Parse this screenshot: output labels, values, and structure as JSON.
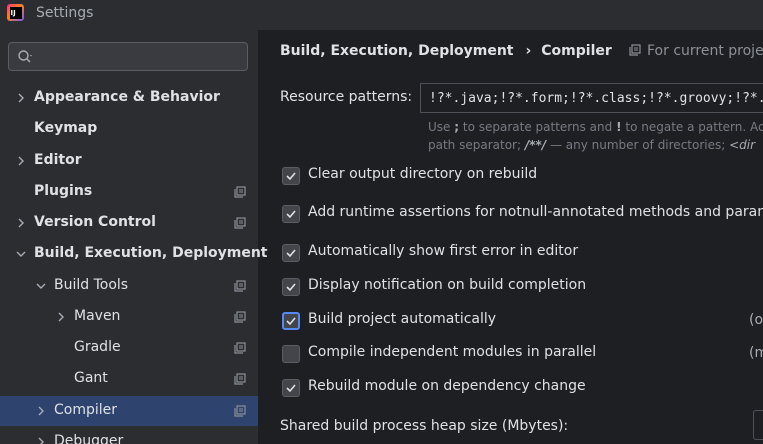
{
  "window": {
    "title": "Settings"
  },
  "search": {
    "placeholder": ""
  },
  "sidebar": {
    "items": [
      {
        "label": "Appearance & Behavior"
      },
      {
        "label": "Keymap"
      },
      {
        "label": "Editor"
      },
      {
        "label": "Plugins"
      },
      {
        "label": "Version Control"
      },
      {
        "label": "Build, Execution, Deployment"
      },
      {
        "label": "Build Tools"
      },
      {
        "label": "Maven"
      },
      {
        "label": "Gradle"
      },
      {
        "label": "Gant"
      },
      {
        "label": "Compiler"
      },
      {
        "label": "Debugger"
      }
    ]
  },
  "main": {
    "breadcrumb": {
      "parent": "Build, Execution, Deployment",
      "separator": "›",
      "current": "Compiler"
    },
    "for_current_project": "For current project",
    "resource_patterns": {
      "label": "Resource patterns:",
      "value": "!?*.java;!?*.form;!?*.class;!?*.groovy;!?*.scala",
      "hint_line1": {
        "a": "Use ",
        "b": ";",
        "c": " to separate patterns and ",
        "d": "!",
        "e": " to negate a pattern. Ac"
      },
      "hint_line2": {
        "a": "path separator; ",
        "b": "/**/",
        "c": " — any number of directories; ",
        "d": "<dir"
      }
    },
    "options": [
      {
        "label": "Clear output directory on rebuild",
        "checked": true
      },
      {
        "label": "Add runtime assertions for notnull-annotated methods and parame",
        "checked": true
      },
      {
        "label": "Automatically show first error in editor",
        "checked": true
      },
      {
        "label": "Display notification on build completion",
        "checked": true
      },
      {
        "label": "Build project automatically",
        "checked": true,
        "note": "(o"
      },
      {
        "label": "Compile independent modules in parallel",
        "checked": false,
        "note": "(m"
      },
      {
        "label": "Rebuild module on dependency change",
        "checked": true
      }
    ],
    "heap_label": "Shared build process heap size (Mbytes):"
  },
  "colors": {
    "background": "#2b2d30",
    "main_background": "#1e1f22",
    "selection": "#2e436e",
    "accent": "#548af7",
    "text": "#dfe1e5"
  }
}
